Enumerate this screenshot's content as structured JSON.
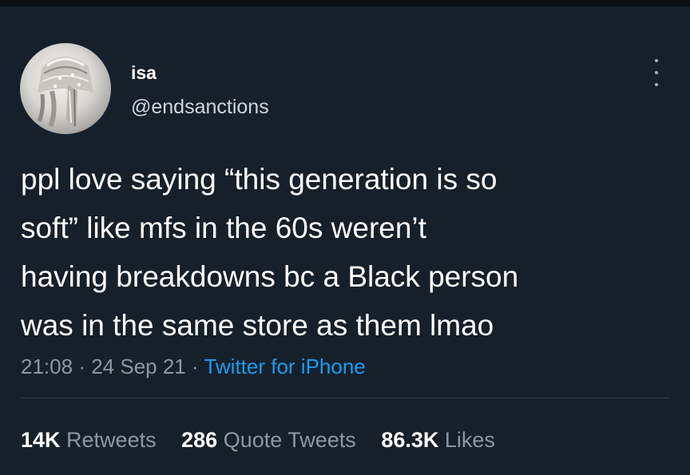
{
  "user": {
    "display_name": "isa",
    "handle": "@endsanctions"
  },
  "tweet": {
    "text": "ppl love saying “this generation is so\nsoft” like mfs in the 60s weren’t\nhaving breakdowns bc a Black person\nwas in the same store as them lmao",
    "time": "21:08",
    "date": "24 Sep 21",
    "separator": "·",
    "source": "Twitter for iPhone"
  },
  "stats": {
    "retweets_count": "14K",
    "retweets_label": "Retweets",
    "quote_tweets_count": "286",
    "quote_tweets_label": "Quote Tweets",
    "likes_count": "86.3K",
    "likes_label": "Likes"
  },
  "icons": {
    "more": "more-vertical-icon"
  },
  "colors": {
    "background": "#15202b",
    "link": "#1d9bf0",
    "secondary_text": "#8b98a5"
  }
}
